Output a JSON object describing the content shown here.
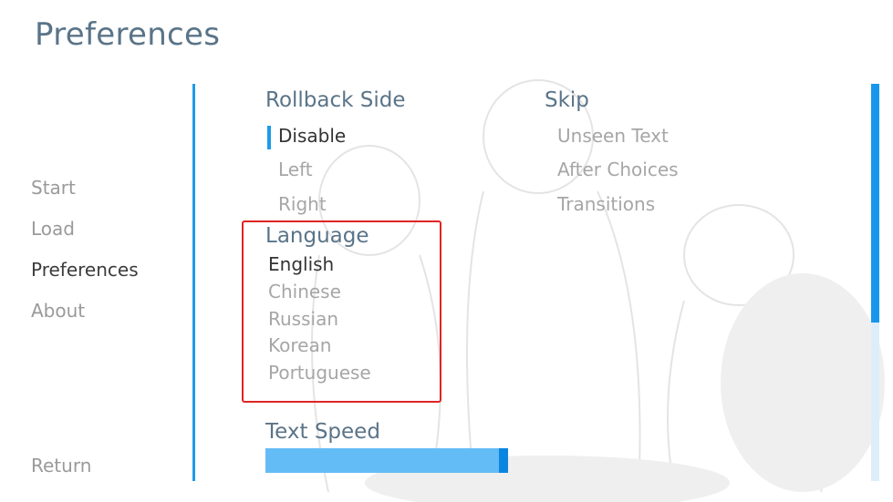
{
  "screen": {
    "title": "Preferences"
  },
  "nav": {
    "items": [
      {
        "label": "Start"
      },
      {
        "label": "Load"
      },
      {
        "label": "Preferences"
      },
      {
        "label": "About"
      }
    ],
    "active": "Preferences",
    "return_label": "Return"
  },
  "rollback": {
    "title": "Rollback Side",
    "options": [
      "Disable",
      "Left",
      "Right"
    ],
    "selected": "Disable"
  },
  "skip": {
    "title": "Skip",
    "options": [
      "Unseen Text",
      "After Choices",
      "Transitions"
    ]
  },
  "language": {
    "title": "Language",
    "options": [
      "English",
      "Chinese",
      "Russian",
      "Korean",
      "Portuguese"
    ],
    "selected": "English"
  },
  "text_speed": {
    "title": "Text Speed",
    "value_fraction": 0.98
  },
  "scrollbar": {
    "visible_fraction": 0.6
  },
  "colors": {
    "accent": "#1e9be8",
    "title": "#5a7488",
    "highlight_box": "#e02424"
  }
}
